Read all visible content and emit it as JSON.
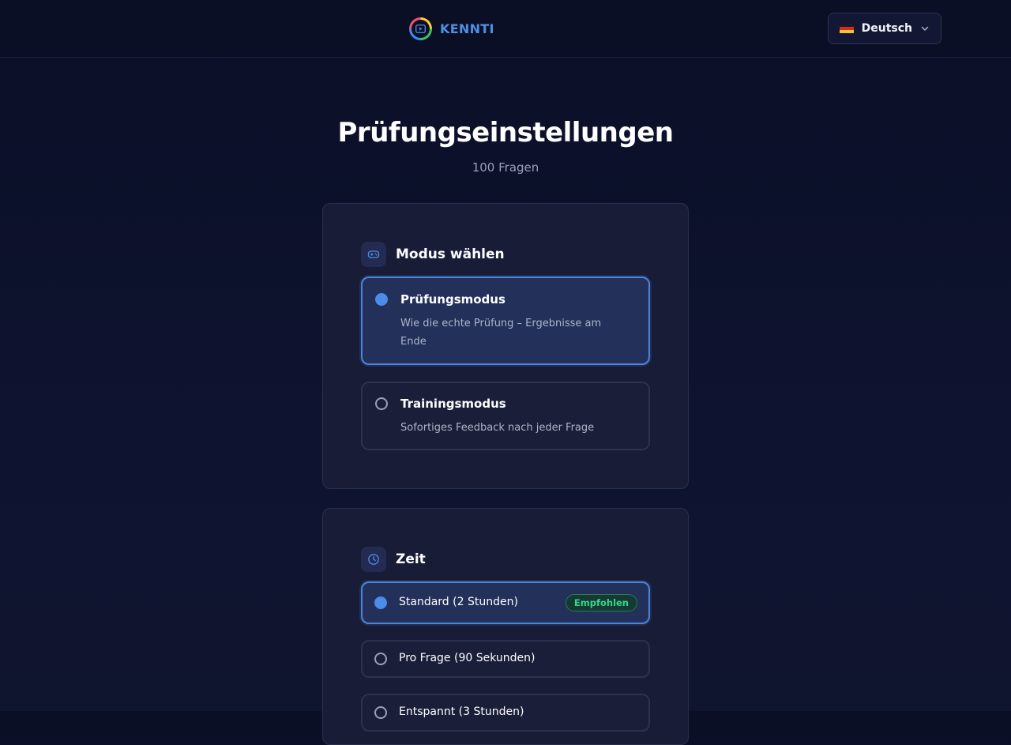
{
  "header": {
    "brand": "KENNTI",
    "language": {
      "label": "Deutsch",
      "flag_icon": "germany-flag-icon"
    }
  },
  "page": {
    "title": "Prüfungseinstellungen",
    "subtitle": "100 Fragen"
  },
  "mode_section": {
    "title": "Modus wählen",
    "icon": "gamepad-icon",
    "options": [
      {
        "title": "Prüfungsmodus",
        "description": "Wie die echte Prüfung – Ergebnisse am Ende",
        "selected": true
      },
      {
        "title": "Trainingsmodus",
        "description": "Sofortiges Feedback nach jeder Frage",
        "selected": false
      }
    ]
  },
  "time_section": {
    "title": "Zeit",
    "icon": "clock-icon",
    "options": [
      {
        "label": "Standard (2 Stunden)",
        "badge": "Empfohlen",
        "selected": true
      },
      {
        "label": "Pro Frage (90 Sekunden)",
        "selected": false
      },
      {
        "label": "Entspannt (3 Stunden)",
        "selected": false
      }
    ]
  },
  "colors": {
    "accent": "#4a8ce8",
    "background": "#0b0f26",
    "card": "#181c36",
    "badge_text": "#3ad48a"
  }
}
